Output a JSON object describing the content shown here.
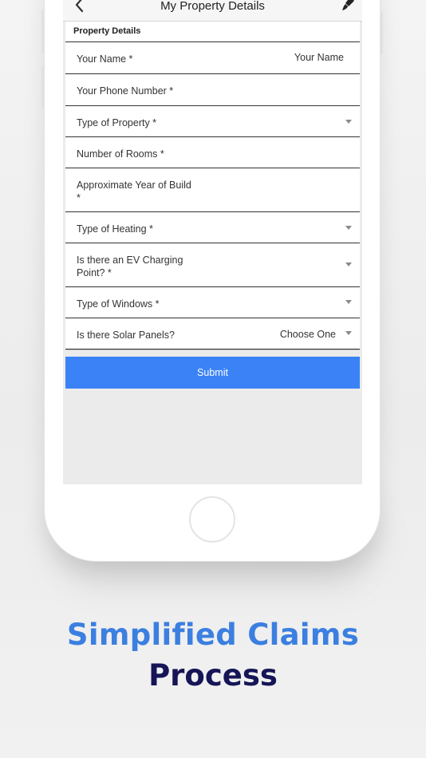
{
  "header": {
    "title": "My Property Details"
  },
  "form": {
    "section_title": "Property Details",
    "fields": [
      {
        "label": "Your Name *",
        "value": "Your Name"
      },
      {
        "label": "Your Phone Number *",
        "value": ""
      },
      {
        "label": "Type of Property *",
        "value": ""
      },
      {
        "label": "Number of Rooms *",
        "value": ""
      },
      {
        "label": "Approximate Year of Build\n*",
        "value": ""
      },
      {
        "label": "Type of Heating *",
        "value": ""
      },
      {
        "label": "Is there an EV Charging Point? *",
        "value": ""
      },
      {
        "label": "Type of Windows *",
        "value": ""
      },
      {
        "label": "Is there Solar Panels?",
        "value": "Choose One"
      }
    ],
    "submit_label": "Submit"
  },
  "marketing": {
    "line1": "Simplified Claims",
    "line2": "Process"
  },
  "colors": {
    "accent": "#3a82f6",
    "headline_blue": "#3b7fe0",
    "headline_navy": "#161557"
  },
  "icons": {
    "back": "chevron-left-icon",
    "edit": "brush-icon",
    "dropdown": "caret-down-icon"
  }
}
